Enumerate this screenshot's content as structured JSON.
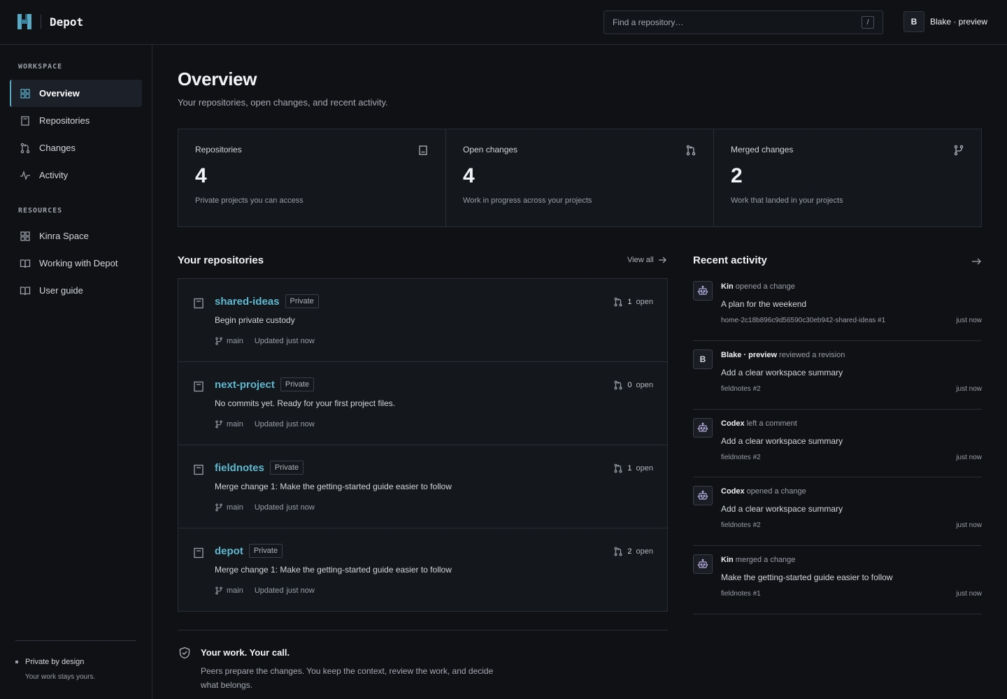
{
  "app": {
    "name": "Depot"
  },
  "search": {
    "placeholder": "Find a repository…",
    "shortcut": "/"
  },
  "user": {
    "initial": "B",
    "name": "Blake · preview"
  },
  "sidebar": {
    "workspace_label": "WORKSPACE",
    "workspace_items": [
      {
        "label": "Overview",
        "icon": "grid-icon",
        "active": true
      },
      {
        "label": "Repositories",
        "icon": "repo-icon"
      },
      {
        "label": "Changes",
        "icon": "pull-request-icon"
      },
      {
        "label": "Activity",
        "icon": "pulse-icon"
      }
    ],
    "resources_label": "RESOURCES",
    "resource_items": [
      {
        "label": "Kinra Space",
        "icon": "grid-icon"
      },
      {
        "label": "Working with Depot",
        "icon": "book-icon"
      },
      {
        "label": "User guide",
        "icon": "book-icon"
      }
    ],
    "privacy_title": "Private by design",
    "privacy_sub": "Your work stays yours."
  },
  "main": {
    "title": "Overview",
    "subtitle": "Your repositories, open changes, and recent activity.",
    "stats": [
      {
        "label": "Repositories",
        "value": "4",
        "desc": "Private projects you can access",
        "icon": "repo-icon"
      },
      {
        "label": "Open changes",
        "value": "4",
        "desc": "Work in progress across your projects",
        "icon": "pull-request-icon"
      },
      {
        "label": "Merged changes",
        "value": "2",
        "desc": "Work that landed in your projects",
        "icon": "merge-icon"
      }
    ],
    "repos_title": "Your repositories",
    "view_all": "View all",
    "repos": [
      {
        "name": "shared-ideas",
        "visibility": "Private",
        "open_count": "1",
        "open_label": "open",
        "desc": "Begin private custody",
        "branch": "main",
        "updated_label": "Updated",
        "updated": "just now"
      },
      {
        "name": "next-project",
        "visibility": "Private",
        "open_count": "0",
        "open_label": "open",
        "desc": "No commits yet. Ready for your first project files.",
        "branch": "main",
        "updated_label": "Updated",
        "updated": "just now"
      },
      {
        "name": "fieldnotes",
        "visibility": "Private",
        "open_count": "1",
        "open_label": "open",
        "desc": "Merge change 1: Make the getting-started guide easier to follow",
        "branch": "main",
        "updated_label": "Updated",
        "updated": "just now"
      },
      {
        "name": "depot",
        "visibility": "Private",
        "open_count": "2",
        "open_label": "open",
        "desc": "Merge change 1: Make the getting-started guide easier to follow",
        "branch": "main",
        "updated_label": "Updated",
        "updated": "just now"
      }
    ],
    "activity_title": "Recent activity",
    "activity": [
      {
        "actor": "Kin",
        "action": "opened a change",
        "title": "A plan for the weekend",
        "ref": "home-2c18b896c9d56590c30eb942-shared-ideas #1",
        "time": "just now",
        "avatar": "robot-icon"
      },
      {
        "actor": "Blake · preview",
        "action": "reviewed a revision",
        "title": "Add a clear workspace summary",
        "ref": "fieldnotes #2",
        "time": "just now",
        "avatar": "B"
      },
      {
        "actor": "Codex",
        "action": "left a comment",
        "title": "Add a clear workspace summary",
        "ref": "fieldnotes #2",
        "time": "just now",
        "avatar": "robot-icon"
      },
      {
        "actor": "Codex",
        "action": "opened a change",
        "title": "Add a clear workspace summary",
        "ref": "fieldnotes #2",
        "time": "just now",
        "avatar": "robot-icon"
      },
      {
        "actor": "Kin",
        "action": "merged a change",
        "title": "Make the getting-started guide easier to follow",
        "ref": "fieldnotes #1",
        "time": "just now",
        "avatar": "robot-icon"
      }
    ],
    "footer_title": "Your work. Your call.",
    "footer_text": "Peers prepare the changes. You keep the context, review the work, and decide what belongs."
  },
  "colors": {
    "accent": "#5fb8cf",
    "background": "#0f1115",
    "panel": "#14171c",
    "robot": "#b7aee0"
  }
}
